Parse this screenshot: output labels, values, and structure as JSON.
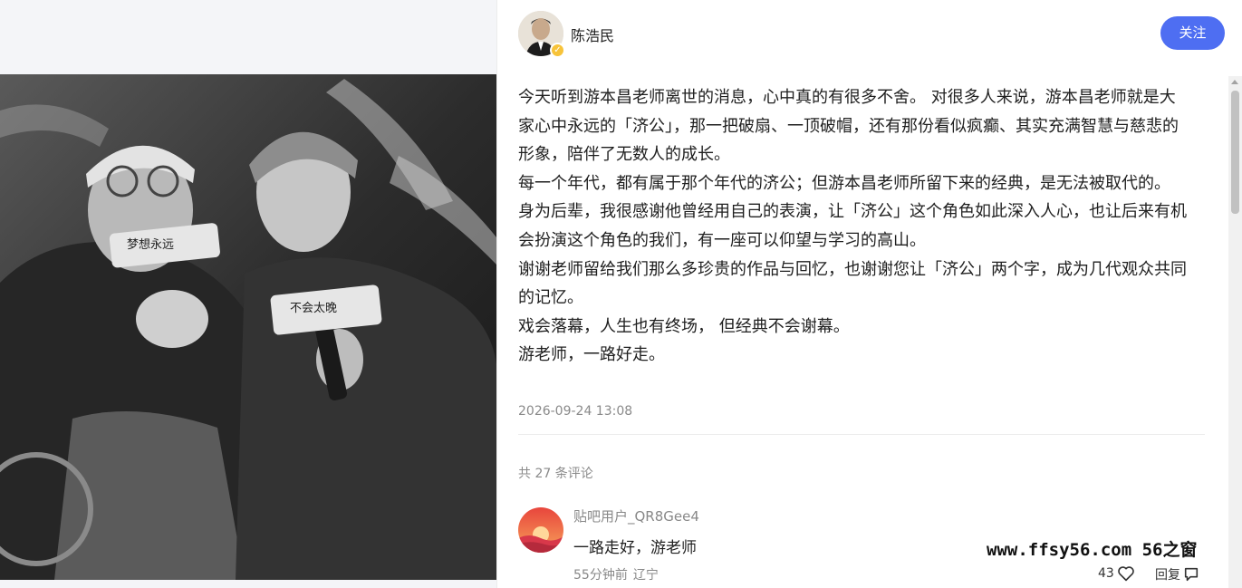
{
  "author": {
    "name": "陈浩民",
    "follow_label": "关注",
    "verified_icon": "verified-badge-icon"
  },
  "post": {
    "paragraphs": [
      "今天听到游本昌老师离世的消息，心中真的有很多不舍。 对很多人来说，游本昌老师就是大家心中永远的「济公」，那一把破扇、一顶破帽，还有那份看似疯癫、其实充满智慧与慈悲的形象，陪伴了无数人的成长。",
      "每一个年代，都有属于那个年代的济公；但游本昌老师所留下来的经典，是无法被取代的。 身为后辈，我很感谢他曾经用自己的表演，让「济公」这个角色如此深入人心，也让后来有机会扮演这个角色的我们，有一座可以仰望与学习的高山。",
      "谢谢老师留给我们那么多珍贵的作品与回忆，也谢谢您让「济公」两个字，成为几代观众共同的记忆。",
      "戏会落幕，人生也有终场， 但经典不会谢幕。",
      "游老师，一路好走。"
    ],
    "time": "2026-09-24 13:08",
    "comment_count": "共 27 条评论"
  },
  "photo": {
    "mic_text_1": "梦想永远",
    "mic_text_2": "不会太晚"
  },
  "comments": [
    {
      "user": "贴吧用户_QR8Gee4",
      "text": "一路走好，游老师",
      "time": "55分钟前",
      "location": "辽宁",
      "likes": "43",
      "reply_label": "回复"
    }
  ],
  "watermark": "www.ffsy56.com 56之窗",
  "colors": {
    "accent": "#4e6ef2",
    "muted": "#8a8a8a"
  }
}
